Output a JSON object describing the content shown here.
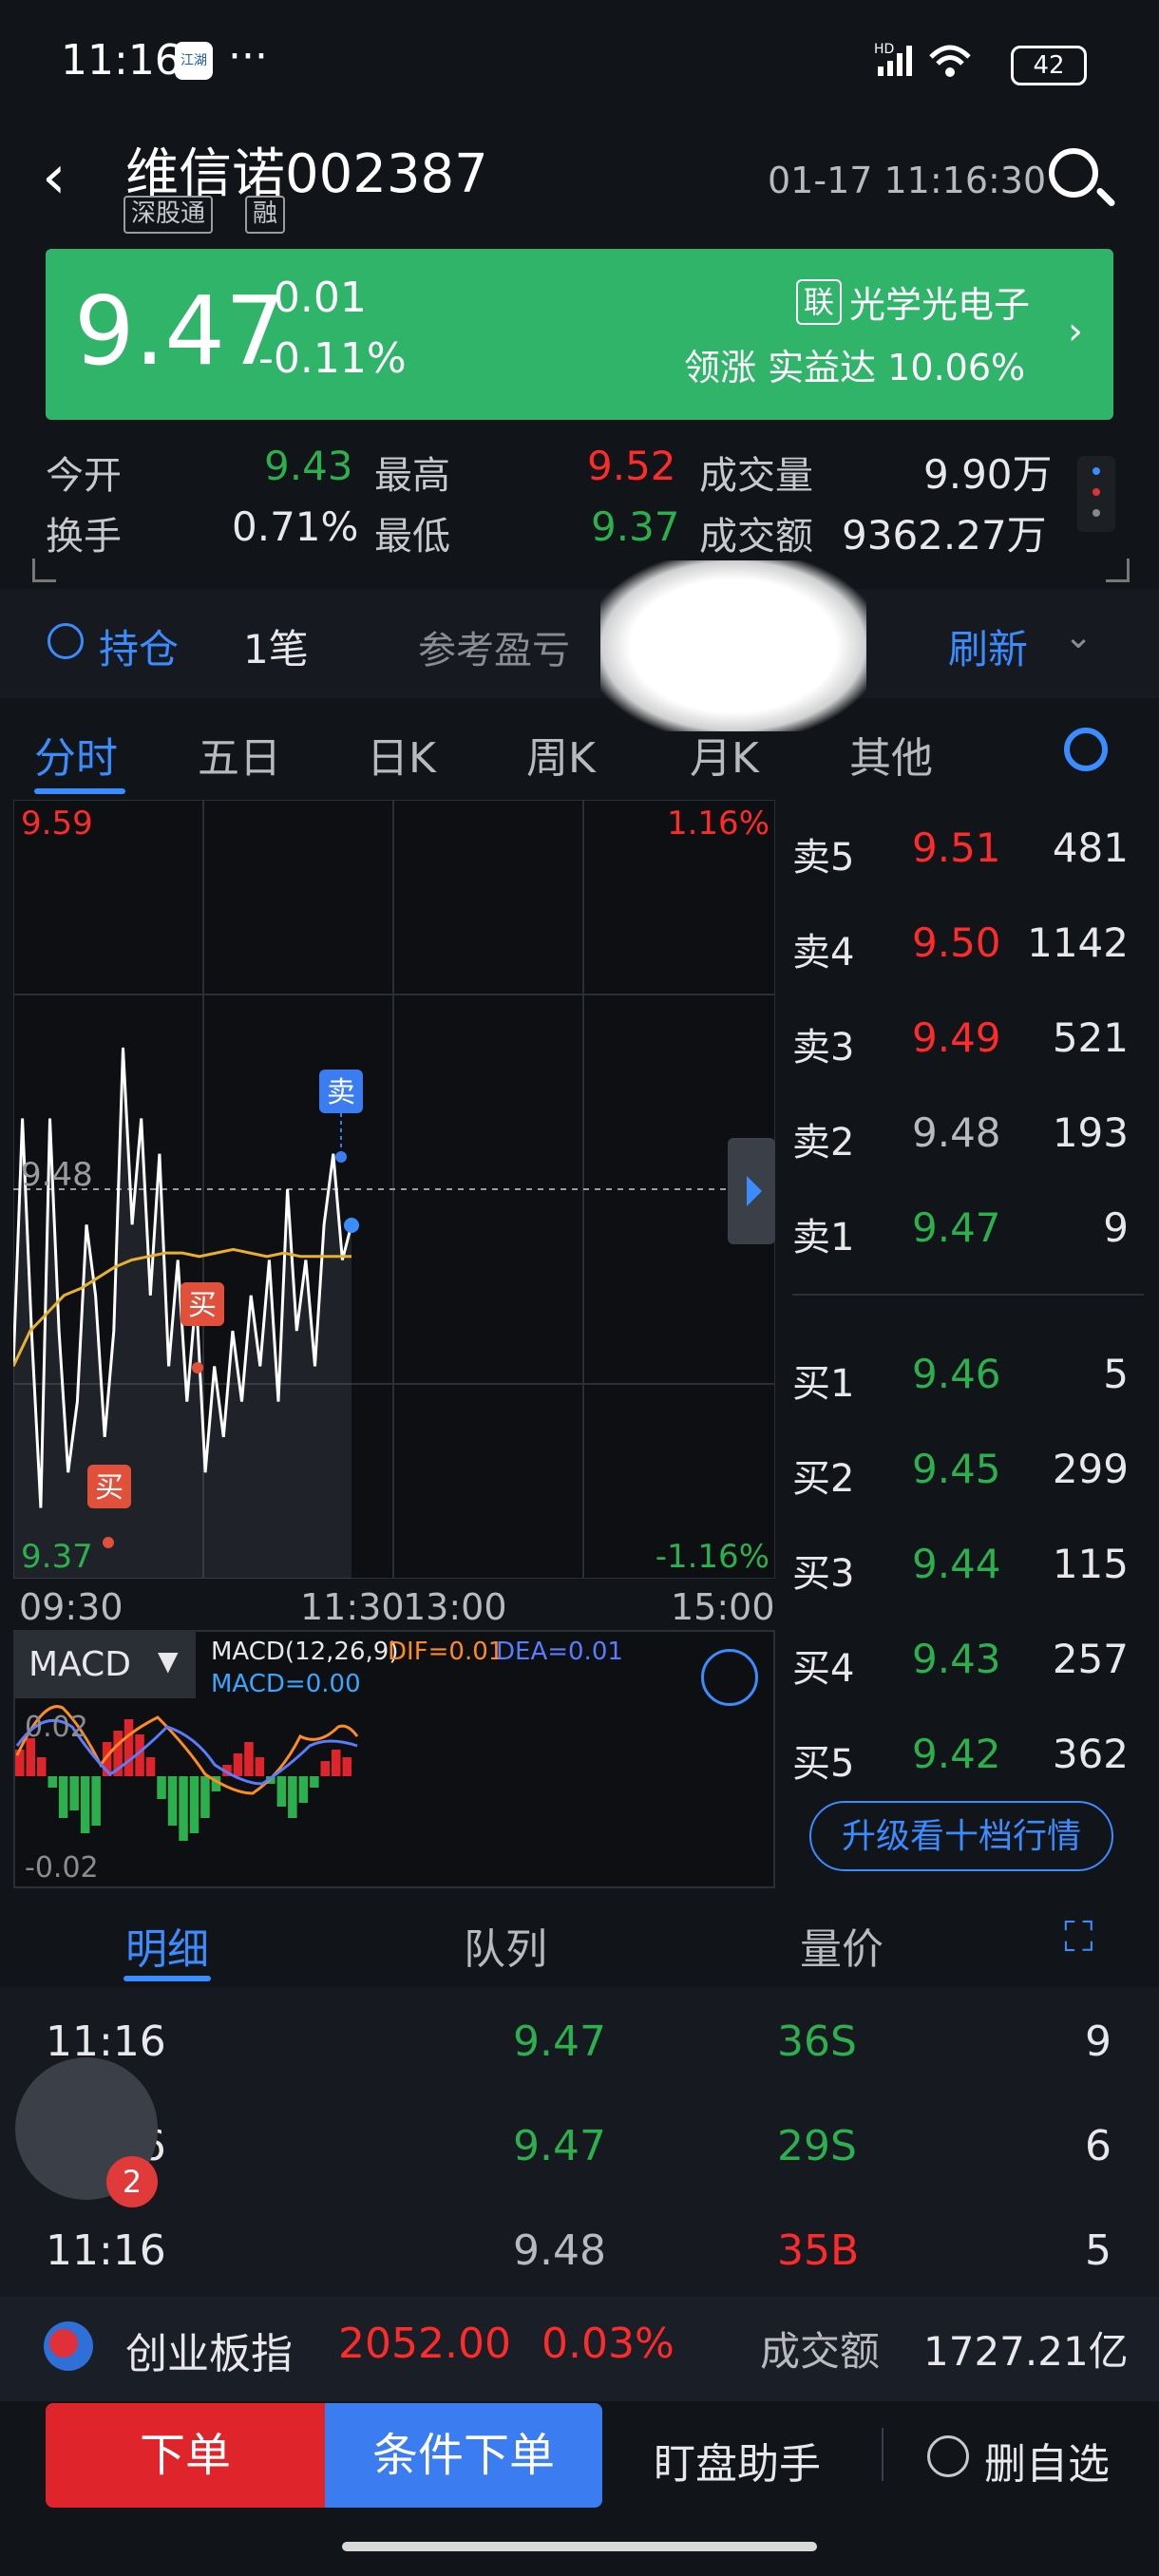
{
  "status_bar": {
    "time": "11:16",
    "dots": "···",
    "battery": "42",
    "signal": "HD",
    "app_icon": "江湖"
  },
  "header": {
    "back": "‹",
    "title": "维信诺002387",
    "tags": [
      "深股通",
      "融"
    ],
    "timestamp": "01-17 11:16:30"
  },
  "price": {
    "current": "9.47",
    "change": "-0.01",
    "change_pct": "-0.11%",
    "sector_badge": "联",
    "sector": "光学光电子",
    "leader_label": "领涨",
    "leader_name": "实益达",
    "leader_pct": "10.06%"
  },
  "stats": {
    "open_label": "今开",
    "open": "9.43",
    "high_label": "最高",
    "high": "9.52",
    "volume_label": "成交量",
    "volume": "9.90万",
    "turnover_label": "换手",
    "turnover": "0.71%",
    "low_label": "最低",
    "low": "9.37",
    "amount_label": "成交额",
    "amount": "9362.27万"
  },
  "holding": {
    "label": "持仓",
    "count": "1笔",
    "pnl_label": "参考盈亏",
    "refresh": "刷新"
  },
  "tabs": [
    "分时",
    "五日",
    "日K",
    "周K",
    "月K",
    "其他"
  ],
  "chart_labels": {
    "y_top": "9.59",
    "y_mid": "9.48",
    "y_bottom": "9.37",
    "pct_top": "1.16%",
    "pct_bottom": "-1.16%",
    "x_ticks": [
      "09:30",
      "11:30",
      "13:00",
      "15:00"
    ],
    "sell_marker": "卖",
    "buy_marker": "买",
    "macd_select": "MACD",
    "macd_params": "MACD(12,26,9)",
    "dif": "DIF=0.01",
    "dea": "DEA=0.01",
    "macd_val": "MACD=0.00",
    "macd_top": "0.02",
    "macd_bottom": "-0.02"
  },
  "chart_data": {
    "type": "line",
    "ylim": [
      9.37,
      9.59
    ],
    "series": [
      {
        "values": [
          9.43,
          9.5,
          9.44,
          9.39,
          9.5,
          9.44,
          9.4,
          9.42,
          9.47,
          9.45,
          9.41,
          9.44,
          9.52,
          9.47,
          9.5,
          9.45,
          9.49,
          9.43,
          9.46,
          9.42,
          9.45,
          9.4,
          9.43,
          9.41,
          9.44,
          9.42,
          9.45,
          9.43,
          9.46,
          9.42,
          9.48,
          9.44,
          9.46,
          9.43,
          9.47,
          9.49,
          9.46,
          9.47
        ]
      },
      {
        "values": [
          9.43,
          9.44,
          9.445,
          9.45,
          9.452,
          9.455,
          9.458,
          9.46,
          9.461,
          9.462,
          9.462,
          9.461,
          9.462,
          9.463,
          9.462,
          9.461,
          9.462,
          9.461,
          9.461,
          9.461,
          9.461
        ]
      }
    ]
  },
  "order_book": {
    "asks": [
      {
        "label": "卖5",
        "price": "9.51",
        "vol": "481",
        "color": "#ff2a2a"
      },
      {
        "label": "卖4",
        "price": "9.50",
        "vol": "1142",
        "color": "#ff2a2a"
      },
      {
        "label": "卖3",
        "price": "9.49",
        "vol": "521",
        "color": "#ff2a2a"
      },
      {
        "label": "卖2",
        "price": "9.48",
        "vol": "193",
        "color": "#b8babd"
      },
      {
        "label": "卖1",
        "price": "9.47",
        "vol": "9",
        "color": "#2bb04d"
      }
    ],
    "bids": [
      {
        "label": "买1",
        "price": "9.46",
        "vol": "5",
        "color": "#2bb04d"
      },
      {
        "label": "买2",
        "price": "9.45",
        "vol": "299",
        "color": "#2bb04d"
      },
      {
        "label": "买3",
        "price": "9.44",
        "vol": "115",
        "color": "#2bb04d"
      },
      {
        "label": "买4",
        "price": "9.43",
        "vol": "257",
        "color": "#2bb04d"
      },
      {
        "label": "买5",
        "price": "9.42",
        "vol": "362",
        "color": "#2bb04d"
      }
    ],
    "upgrade": "升级看十档行情"
  },
  "detail_tabs": [
    "明细",
    "队列",
    "量价"
  ],
  "deals": [
    {
      "time": "11:16",
      "price": "9.47",
      "vol": "36S",
      "qty": "9",
      "price_color": "#2bb04d",
      "vol_color": "#2bb04d"
    },
    {
      "time": "11:16",
      "price": "9.47",
      "vol": "29S",
      "qty": "6",
      "price_color": "#2bb04d",
      "vol_color": "#2bb04d"
    },
    {
      "time": "11:16",
      "price": "9.48",
      "vol": "35B",
      "qty": "5",
      "price_color": "#b8babd",
      "vol_color": "#ff2a2a"
    }
  ],
  "avatar_badge": "2",
  "index": {
    "name": "创业板指",
    "value": "2052.00",
    "pct": "0.03%",
    "amount_label": "成交额",
    "amount": "1727.21亿"
  },
  "bottom": {
    "order": "下单",
    "conditional": "条件下单",
    "assistant": "盯盘助手",
    "remove": "删自选"
  },
  "colors": {
    "up": "#ff2a2a",
    "down": "#2bb04d",
    "accent": "#3b8cff",
    "price_bg": "#2fb46a"
  }
}
